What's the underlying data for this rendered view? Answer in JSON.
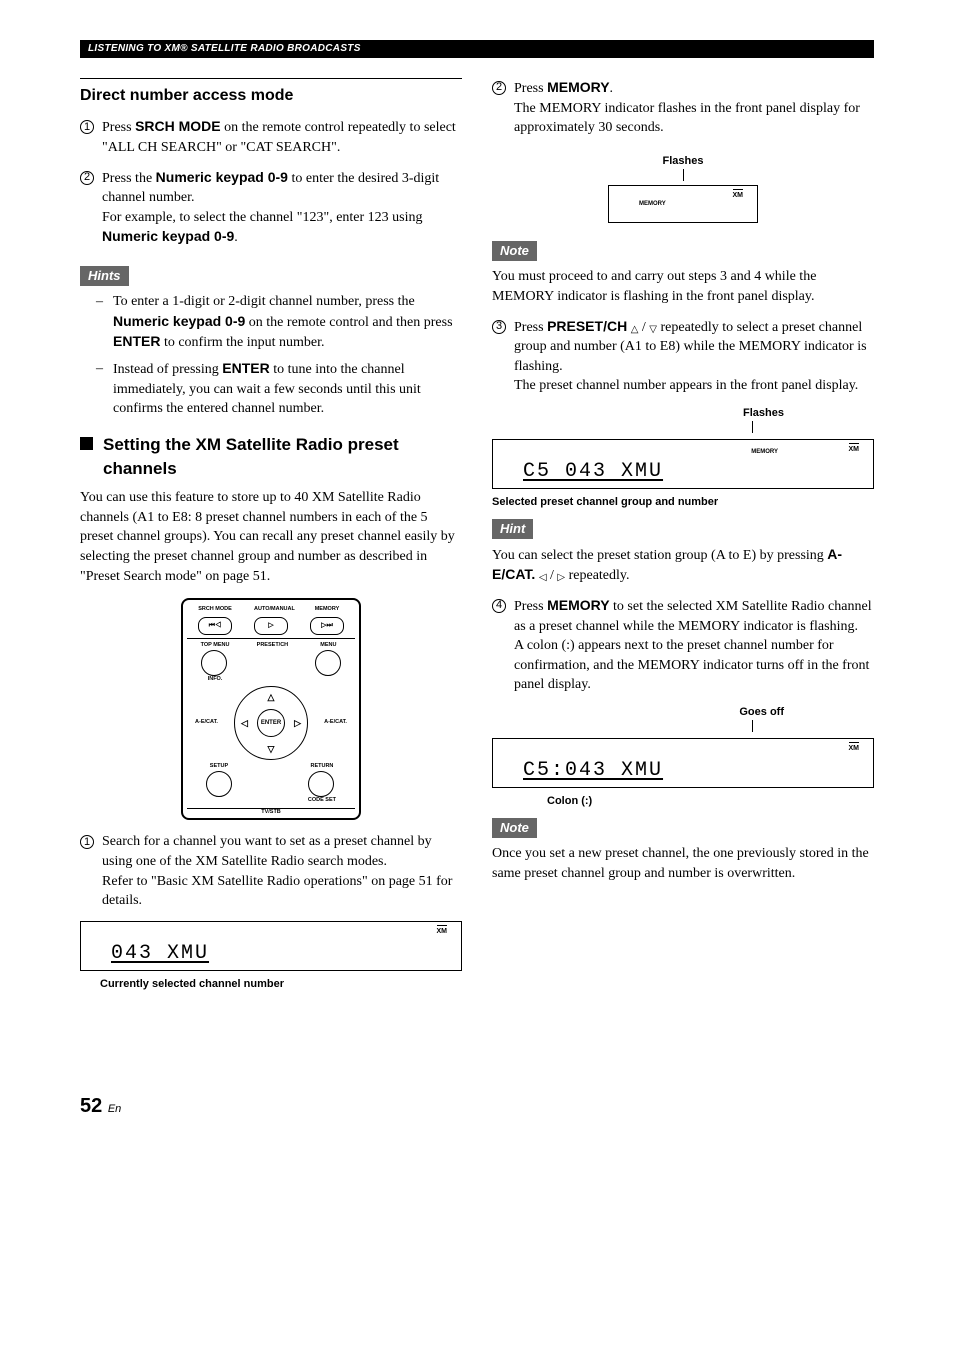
{
  "header": "LISTENING TO XM® SATELLITE RADIO BROADCASTS",
  "left": {
    "title": "Direct number access mode",
    "step1": {
      "text_a": "Press ",
      "bold": "SRCH MODE",
      "text_b": " on the remote control repeatedly to select \"ALL CH SEARCH\" or \"CAT SEARCH\"."
    },
    "step2": {
      "text_a": "Press the ",
      "bold1": "Numeric keypad 0-9",
      "text_b": " to enter the desired 3-digit channel number.",
      "text_c": "For example, to select the channel \"123\", enter 123 using ",
      "bold2": "Numeric keypad 0-9",
      "text_d": "."
    },
    "hints_label": "Hints",
    "hint1": {
      "a": "To enter a 1-digit or 2-digit channel number, press the ",
      "b": "Numeric keypad 0-9",
      "c": " on the remote control and then press ",
      "d": "ENTER",
      "e": " to confirm the input number."
    },
    "hint2": {
      "a": "Instead of pressing ",
      "b": "ENTER",
      "c": " to tune into the channel immediately, you can wait a few seconds until this unit confirms the entered channel number."
    },
    "subheading": "Setting the XM Satellite Radio preset channels",
    "intro": "You can use this feature to store up to 40 XM Satellite Radio channels (A1 to E8: 8 preset channel numbers in each of the 5 preset channel groups). You can recall any preset channel easily by selecting the preset channel group and number as described in \"Preset Search mode\" on page 51.",
    "remote": {
      "r1": [
        "SRCH MODE",
        "AUTO/MANUAL",
        "MEMORY"
      ],
      "r2": [
        "⏮◁",
        "▷",
        "▷⏭"
      ],
      "r3_left": "TOP MENU",
      "r3_mid": "PRESET/CH",
      "r3_right": "MENU",
      "info": "INFO.",
      "aecat": "A-E/CAT.",
      "enter": "ENTER",
      "setup": "SETUP",
      "return": "RETURN",
      "codeset": "CODE SET",
      "tvstb": "TV/STB"
    },
    "pstep1": {
      "a": "Search for a channel you want to set as a preset channel by using one of the XM Satellite Radio search modes.",
      "b": "Refer to \"Basic XM Satellite Radio operations\" on page 51 for details."
    },
    "display1": {
      "text": "043 XMU",
      "xm": "XM"
    },
    "caption1": "Currently selected channel number"
  },
  "right": {
    "step2": {
      "a": "Press ",
      "b": "MEMORY",
      "c": ".",
      "d": "The MEMORY indicator flashes in the front panel display for approximately 30 seconds."
    },
    "flashes": "Flashes",
    "memory_label": "MEMORY",
    "xm": "XM",
    "note_label": "Note",
    "note1": "You must proceed to and carry out steps 3 and 4 while the MEMORY indicator is flashing in the front panel display.",
    "step3": {
      "a": "Press ",
      "b": "PRESET/CH",
      "c": " repeatedly to select a preset channel group and number (A1 to E8) while the MEMORY indicator is flashing.",
      "d": "The preset channel number appears in the front panel display."
    },
    "display2": {
      "text": "C5 043 XMU"
    },
    "caption2": "Selected preset channel group and number",
    "hint_label": "Hint",
    "hint_text": {
      "a": "You can select the preset station group (A to E) by pressing ",
      "b": "A-E/CAT.",
      "c": " repeatedly."
    },
    "step4": {
      "a": "Press ",
      "b": "MEMORY",
      "c": " to set the selected XM Satellite Radio channel as a preset channel while the MEMORY indicator is flashing.",
      "d": "A colon (:) appears next to the preset channel number for confirmation, and the MEMORY indicator turns off in the front panel display."
    },
    "goes_off": "Goes off",
    "display3": {
      "text": "C5:043 XMU"
    },
    "colon": "Colon (:)",
    "note2": "Once you set a new preset channel, the one previously stored in the same preset channel group and number is overwritten."
  },
  "page": {
    "num": "52",
    "suffix": "En"
  }
}
